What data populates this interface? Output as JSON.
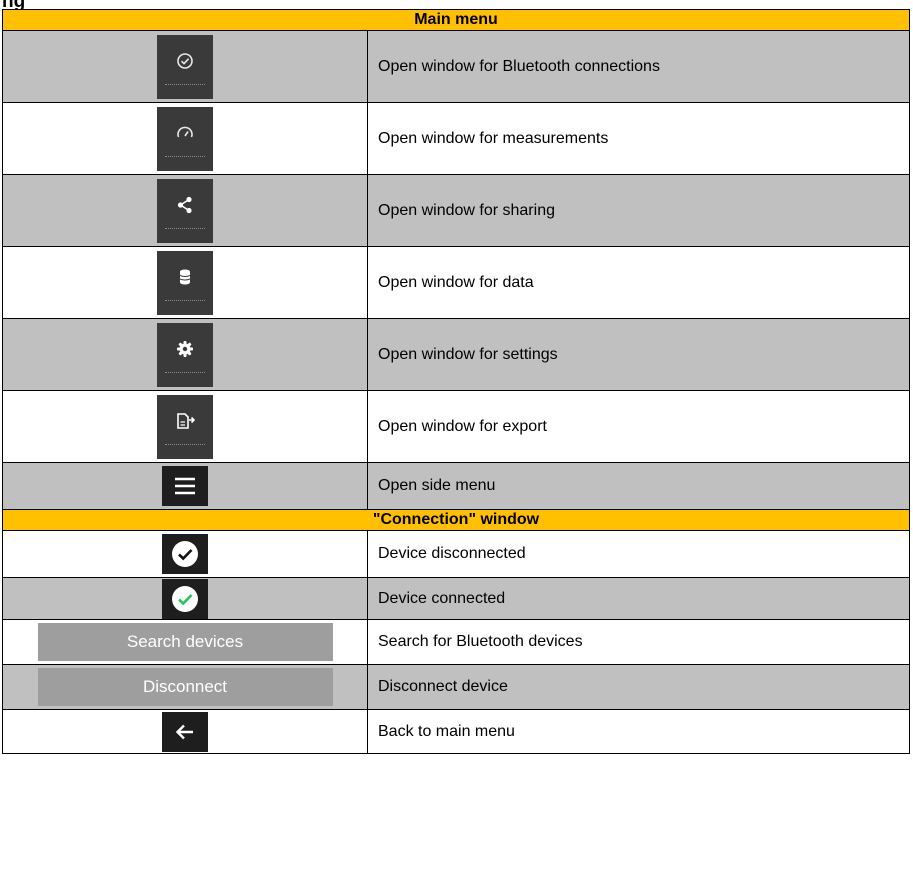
{
  "page": {
    "clipped_title": "…ng"
  },
  "sections": [
    {
      "header": "Main menu",
      "rows": [
        {
          "icon": "check-circle-icon",
          "text": "Open window for Bluetooth connections"
        },
        {
          "icon": "gauge-icon",
          "text": "Open window for measurements"
        },
        {
          "icon": "share-icon",
          "text": "Open window for sharing"
        },
        {
          "icon": "database-icon",
          "text": "Open window for data"
        },
        {
          "icon": "gear-icon",
          "text": "Open window for settings"
        },
        {
          "icon": "export-icon",
          "text": "Open window for export"
        },
        {
          "icon": "hamburger-menu-icon",
          "text": "Open side menu"
        }
      ]
    },
    {
      "header": "\"Connection\" window",
      "rows": [
        {
          "icon": "check-circle-white-icon",
          "text": "Device disconnected"
        },
        {
          "icon": "check-circle-green-icon",
          "text": "Device connected"
        },
        {
          "button_label": "Search devices",
          "text": "Search for Bluetooth devices"
        },
        {
          "button_label": "Disconnect",
          "text": "Disconnect device"
        },
        {
          "icon": "back-arrow-icon",
          "text": "Back to main menu"
        }
      ]
    }
  ],
  "colors": {
    "header_bg": "#ffc000",
    "alt_row_bg": "#c0c0c0",
    "tile_bg": "#3a3a3a",
    "connected_check": "#22c55e"
  }
}
